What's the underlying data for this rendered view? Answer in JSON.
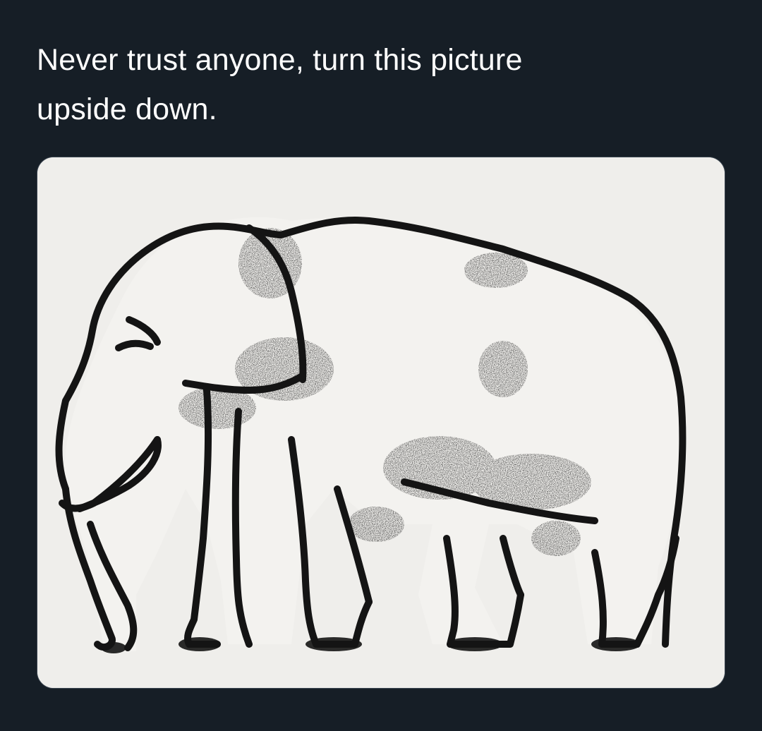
{
  "post": {
    "text_line_1": "Never trust anyone, turn this picture",
    "text_line_2": "upside down."
  },
  "media": {
    "icon": "elephant-illusion-drawing",
    "background_color": "#efeeeb",
    "ink_color": "#141414"
  },
  "theme": {
    "background": "#161e26",
    "text": "#ffffff",
    "card_border": "#3a4550"
  }
}
